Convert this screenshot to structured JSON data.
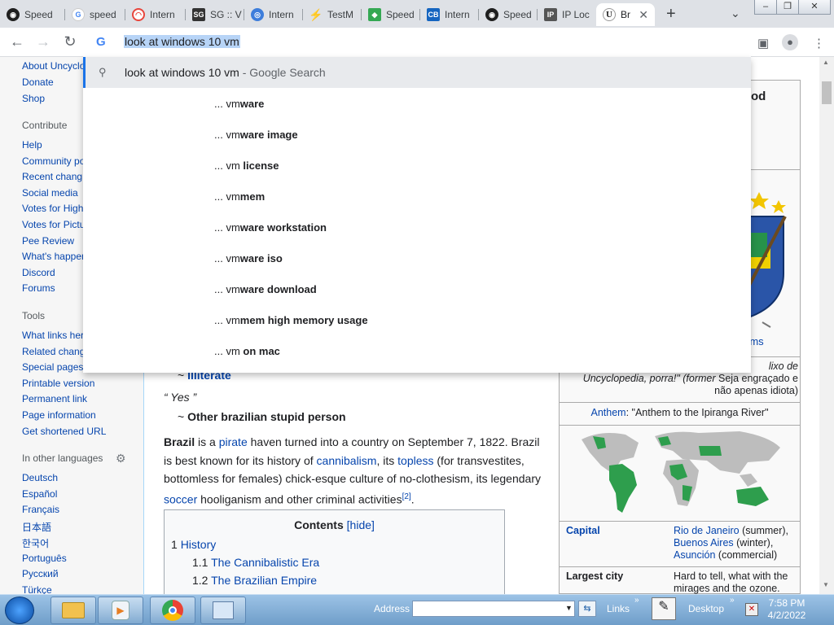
{
  "browser": {
    "tabs": [
      {
        "label": "Speed",
        "icon": "speedtest-icon",
        "color": "#1f1f1f"
      },
      {
        "label": "speed",
        "icon": "google-icon",
        "color": "#4285f4"
      },
      {
        "label": "Intern",
        "icon": "gauge-icon",
        "color": "#e8453c"
      },
      {
        "label": "SG :: V",
        "icon": "sg-icon",
        "color": "#333333"
      },
      {
        "label": "Intern",
        "icon": "globe-icon",
        "color": "#3d7ddb"
      },
      {
        "label": "TestM",
        "icon": "bolt-icon",
        "color": "#444444"
      },
      {
        "label": "Speed",
        "icon": "map-icon",
        "color": "#34a853"
      },
      {
        "label": "Intern",
        "icon": "cb-icon",
        "color": "#1565c0"
      },
      {
        "label": "Speed",
        "icon": "speedtest-icon",
        "color": "#1f1f1f"
      },
      {
        "label": "IP Loc",
        "icon": "ip-icon",
        "color": "#555555"
      },
      {
        "label": "Br",
        "icon": "uncyclopedia-icon",
        "color": "#222222"
      }
    ],
    "new_tab": "+",
    "omnibox_text": "look at windows 10 vm",
    "suggestions": {
      "top_query": "look at windows 10 vm",
      "top_hint": " - Google Search",
      "items": [
        {
          "prefix": "... vm",
          "bold": "ware"
        },
        {
          "prefix": "... vm",
          "bold": "ware image"
        },
        {
          "prefix": "... vm ",
          "bold": "license"
        },
        {
          "prefix": "... vm",
          "bold": "mem"
        },
        {
          "prefix": "... vm",
          "bold": "ware workstation"
        },
        {
          "prefix": "... vm",
          "bold": "ware iso"
        },
        {
          "prefix": "... vm",
          "bold": "ware download"
        },
        {
          "prefix": "... vm",
          "bold": "mem high memory usage"
        },
        {
          "prefix": "... vm ",
          "bold": "on mac"
        }
      ]
    }
  },
  "sidebar": {
    "top_links": [
      "About Uncyclo",
      "Donate",
      "Shop"
    ],
    "contribute_heading": "Contribute",
    "contribute_links": [
      "Help",
      "Community po",
      "Recent chang",
      "Social media",
      "Votes for High",
      "Votes for Pictu",
      "Pee Review",
      "What's happen",
      "Discord",
      "Forums"
    ],
    "tools_heading": "Tools",
    "tools_links": [
      "What links her",
      "Related chang",
      "Special pages",
      "Printable version",
      "Permanent link",
      "Page information",
      "Get shortened URL"
    ],
    "languages_heading": "In other languages",
    "languages": [
      "Deutsch",
      "Español",
      "Français",
      "日本語",
      "한국어",
      "Português",
      "Русский",
      "Türkçe"
    ]
  },
  "article": {
    "quote_attrib_1_tilde": "~ ",
    "quote_attrib_1": "Illiterate",
    "quote_2": "“ Yes ”",
    "quote_attrib_2_tilde": "~ ",
    "quote_attrib_2": "Other brazilian stupid person",
    "para": {
      "brazil": "Brazil",
      "t1": " is a ",
      "pirate": "pirate",
      "t2": " haven turned into a country on September 7, 1822. Brazil",
      "t3": "is best known for its history of ",
      "cannibalism": "cannibalism",
      "t4": ", its ",
      "topless": "topless",
      "t5": " (for transvestites,",
      "t6": "bottomless for females) chick-esque culture of no-clothesism, its legendary",
      "soccer": "soccer",
      "t7": " hooliganism and other criminal activities",
      "ref": "[2]",
      "t8": "."
    },
    "toc": {
      "title": "Contents",
      "hide": "[hide]",
      "items": [
        {
          "num": "1",
          "label": "History"
        },
        {
          "num": "1.1",
          "label": "The Cannibalistic Era"
        },
        {
          "num": "1.2",
          "label": "The Brazilian Empire"
        }
      ]
    }
  },
  "infobox": {
    "title_fragment": "od",
    "arms_fragment": "rms",
    "motto_line1": "lixo de",
    "motto_line2_italic": "Uncyclopedia, porra!\" (former",
    "motto_line2_rest": " Seja engraçado e",
    "motto_line3": "não apenas idiota)",
    "anthem_label": "Anthem",
    "anthem_value": ": \"Anthem to the Ipiranga River\"",
    "capital_label": "Capital",
    "capital_1": "Rio de Janeiro",
    "capital_1s": " (summer),",
    "capital_2": "Buenos Aires",
    "capital_2s": " (winter),",
    "capital_3": "Asunción",
    "capital_3s": " (commercial)",
    "largest_city_label": "Largest city",
    "largest_city_1": "Hard to tell, what with the",
    "largest_city_2": "mirages and the ozone."
  },
  "taskbar": {
    "address_label": "Address",
    "links_label": "Links",
    "desktop_label": "Desktop",
    "time": "7:58 PM",
    "date": "4/2/2022"
  },
  "colors": {
    "link": "#0645ad",
    "redlink": "#ba0000",
    "accent": "#1a73e8",
    "map_green": "#2e9e4d"
  }
}
